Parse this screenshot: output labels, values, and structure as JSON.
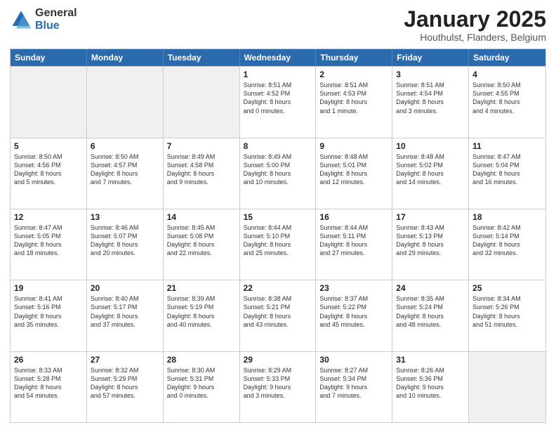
{
  "logo": {
    "general": "General",
    "blue": "Blue"
  },
  "header": {
    "month": "January 2025",
    "location": "Houthulst, Flanders, Belgium"
  },
  "days": [
    "Sunday",
    "Monday",
    "Tuesday",
    "Wednesday",
    "Thursday",
    "Friday",
    "Saturday"
  ],
  "weeks": [
    [
      {
        "day": "",
        "content": ""
      },
      {
        "day": "",
        "content": ""
      },
      {
        "day": "",
        "content": ""
      },
      {
        "day": "1",
        "content": "Sunrise: 8:51 AM\nSunset: 4:52 PM\nDaylight: 8 hours\nand 0 minutes."
      },
      {
        "day": "2",
        "content": "Sunrise: 8:51 AM\nSunset: 4:53 PM\nDaylight: 8 hours\nand 1 minute."
      },
      {
        "day": "3",
        "content": "Sunrise: 8:51 AM\nSunset: 4:54 PM\nDaylight: 8 hours\nand 3 minutes."
      },
      {
        "day": "4",
        "content": "Sunrise: 8:50 AM\nSunset: 4:55 PM\nDaylight: 8 hours\nand 4 minutes."
      }
    ],
    [
      {
        "day": "5",
        "content": "Sunrise: 8:50 AM\nSunset: 4:56 PM\nDaylight: 8 hours\nand 5 minutes."
      },
      {
        "day": "6",
        "content": "Sunrise: 8:50 AM\nSunset: 4:57 PM\nDaylight: 8 hours\nand 7 minutes."
      },
      {
        "day": "7",
        "content": "Sunrise: 8:49 AM\nSunset: 4:58 PM\nDaylight: 8 hours\nand 9 minutes."
      },
      {
        "day": "8",
        "content": "Sunrise: 8:49 AM\nSunset: 5:00 PM\nDaylight: 8 hours\nand 10 minutes."
      },
      {
        "day": "9",
        "content": "Sunrise: 8:48 AM\nSunset: 5:01 PM\nDaylight: 8 hours\nand 12 minutes."
      },
      {
        "day": "10",
        "content": "Sunrise: 8:48 AM\nSunset: 5:02 PM\nDaylight: 8 hours\nand 14 minutes."
      },
      {
        "day": "11",
        "content": "Sunrise: 8:47 AM\nSunset: 5:04 PM\nDaylight: 8 hours\nand 16 minutes."
      }
    ],
    [
      {
        "day": "12",
        "content": "Sunrise: 8:47 AM\nSunset: 5:05 PM\nDaylight: 8 hours\nand 18 minutes."
      },
      {
        "day": "13",
        "content": "Sunrise: 8:46 AM\nSunset: 5:07 PM\nDaylight: 8 hours\nand 20 minutes."
      },
      {
        "day": "14",
        "content": "Sunrise: 8:45 AM\nSunset: 5:08 PM\nDaylight: 8 hours\nand 22 minutes."
      },
      {
        "day": "15",
        "content": "Sunrise: 8:44 AM\nSunset: 5:10 PM\nDaylight: 8 hours\nand 25 minutes."
      },
      {
        "day": "16",
        "content": "Sunrise: 8:44 AM\nSunset: 5:11 PM\nDaylight: 8 hours\nand 27 minutes."
      },
      {
        "day": "17",
        "content": "Sunrise: 8:43 AM\nSunset: 5:13 PM\nDaylight: 8 hours\nand 29 minutes."
      },
      {
        "day": "18",
        "content": "Sunrise: 8:42 AM\nSunset: 5:14 PM\nDaylight: 8 hours\nand 32 minutes."
      }
    ],
    [
      {
        "day": "19",
        "content": "Sunrise: 8:41 AM\nSunset: 5:16 PM\nDaylight: 8 hours\nand 35 minutes."
      },
      {
        "day": "20",
        "content": "Sunrise: 8:40 AM\nSunset: 5:17 PM\nDaylight: 8 hours\nand 37 minutes."
      },
      {
        "day": "21",
        "content": "Sunrise: 8:39 AM\nSunset: 5:19 PM\nDaylight: 8 hours\nand 40 minutes."
      },
      {
        "day": "22",
        "content": "Sunrise: 8:38 AM\nSunset: 5:21 PM\nDaylight: 8 hours\nand 43 minutes."
      },
      {
        "day": "23",
        "content": "Sunrise: 8:37 AM\nSunset: 5:22 PM\nDaylight: 8 hours\nand 45 minutes."
      },
      {
        "day": "24",
        "content": "Sunrise: 8:35 AM\nSunset: 5:24 PM\nDaylight: 8 hours\nand 48 minutes."
      },
      {
        "day": "25",
        "content": "Sunrise: 8:34 AM\nSunset: 5:26 PM\nDaylight: 8 hours\nand 51 minutes."
      }
    ],
    [
      {
        "day": "26",
        "content": "Sunrise: 8:33 AM\nSunset: 5:28 PM\nDaylight: 8 hours\nand 54 minutes."
      },
      {
        "day": "27",
        "content": "Sunrise: 8:32 AM\nSunset: 5:29 PM\nDaylight: 8 hours\nand 57 minutes."
      },
      {
        "day": "28",
        "content": "Sunrise: 8:30 AM\nSunset: 5:31 PM\nDaylight: 9 hours\nand 0 minutes."
      },
      {
        "day": "29",
        "content": "Sunrise: 8:29 AM\nSunset: 5:33 PM\nDaylight: 9 hours\nand 3 minutes."
      },
      {
        "day": "30",
        "content": "Sunrise: 8:27 AM\nSunset: 5:34 PM\nDaylight: 9 hours\nand 7 minutes."
      },
      {
        "day": "31",
        "content": "Sunrise: 8:26 AM\nSunset: 5:36 PM\nDaylight: 9 hours\nand 10 minutes."
      },
      {
        "day": "",
        "content": ""
      }
    ]
  ]
}
